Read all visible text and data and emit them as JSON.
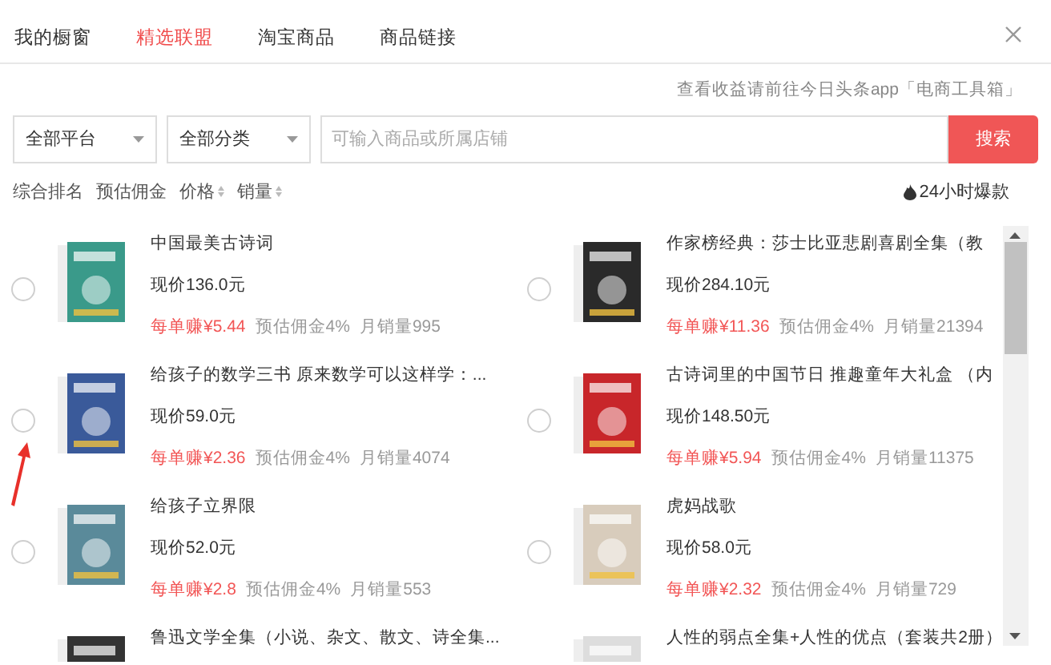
{
  "tabs": [
    {
      "label": "我的橱窗",
      "selected": false
    },
    {
      "label": "精选联盟",
      "selected": true
    },
    {
      "label": "淘宝商品",
      "selected": false
    },
    {
      "label": "商品链接",
      "selected": false
    }
  ],
  "notice": "查看收益请前往今日头条app「电商工具箱」",
  "filters": [
    {
      "label": "全部平台"
    },
    {
      "label": "全部分类"
    }
  ],
  "search": {
    "placeholder": "可输入商品或所属店铺",
    "button": "搜索"
  },
  "sort": [
    {
      "label": "综合排名",
      "sortable": false
    },
    {
      "label": "预估佣金",
      "sortable": false
    },
    {
      "label": "价格",
      "sortable": true
    },
    {
      "label": "销量",
      "sortable": true
    }
  ],
  "hot": "24小时爆款",
  "products": [
    {
      "title": "中国最美古诗词",
      "price": "现价136.0元",
      "earn": "每单赚¥5.44",
      "commission": "预估佣金4%",
      "sales": "月销量995",
      "selected": false
    },
    {
      "title": "作家榜经典：莎士比亚悲剧喜剧全集（教",
      "price": "现价284.10元",
      "earn": "每单赚¥11.36",
      "commission": "预估佣金4%",
      "sales": "月销量21394",
      "selected": false
    },
    {
      "title": "给孩子的数学三书 原来数学可以这样学：...",
      "price": "现价59.0元",
      "earn": "每单赚¥2.36",
      "commission": "预估佣金4%",
      "sales": "月销量4074",
      "selected": false
    },
    {
      "title": "古诗词里的中国节日 推趣童年大礼盒 （内",
      "price": "现价148.50元",
      "earn": "每单赚¥5.94",
      "commission": "预估佣金4%",
      "sales": "月销量11375",
      "selected": false
    },
    {
      "title": "给孩子立界限",
      "price": "现价52.0元",
      "earn": "每单赚¥2.8",
      "commission": "预估佣金4%",
      "sales": "月销量553",
      "selected": false
    },
    {
      "title": "虎妈战歌",
      "price": "现价58.0元",
      "earn": "每单赚¥2.32",
      "commission": "预估佣金4%",
      "sales": "月销量729",
      "selected": false
    },
    {
      "title": "鲁迅文学全集（小说、杂文、散文、诗全集..."
    },
    {
      "title": "人性的弱点全集+人性的优点（套装共2册）"
    }
  ]
}
